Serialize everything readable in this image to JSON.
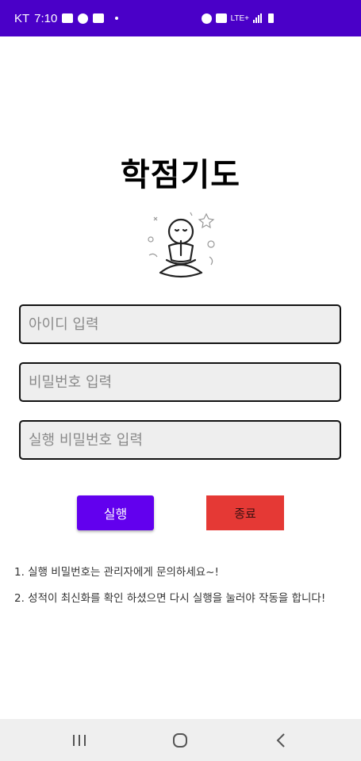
{
  "status_bar": {
    "carrier": "KT",
    "time": "7:10",
    "network": "LTE+"
  },
  "app": {
    "title": "학점기도"
  },
  "form": {
    "id_placeholder": "아이디 입력",
    "password_placeholder": "비밀번호 입력",
    "run_password_placeholder": "실행 비밀번호 입력"
  },
  "buttons": {
    "run_label": "실행",
    "exit_label": "종료"
  },
  "notes": [
    "1. 실행 비밀번호는 관리자에게 문의하세요~!",
    "2. 성적이 최신화를 확인 하셨으면 다시 실행을 눌러야 작동을 합니다!"
  ],
  "colors": {
    "status_bar": "#4a00c8",
    "run_button": "#6200ee",
    "exit_button": "#e53935",
    "field_background": "#eeeeee",
    "nav_bar": "#efefef"
  },
  "icons": {
    "status_left": [
      "image-icon",
      "chat-icon",
      "note-icon",
      "dot-icon"
    ],
    "status_right": [
      "alarm-icon",
      "mute-icon",
      "hd-icon",
      "signal-icon",
      "battery-icon"
    ],
    "nav": [
      "recents-icon",
      "home-icon",
      "back-icon"
    ]
  }
}
